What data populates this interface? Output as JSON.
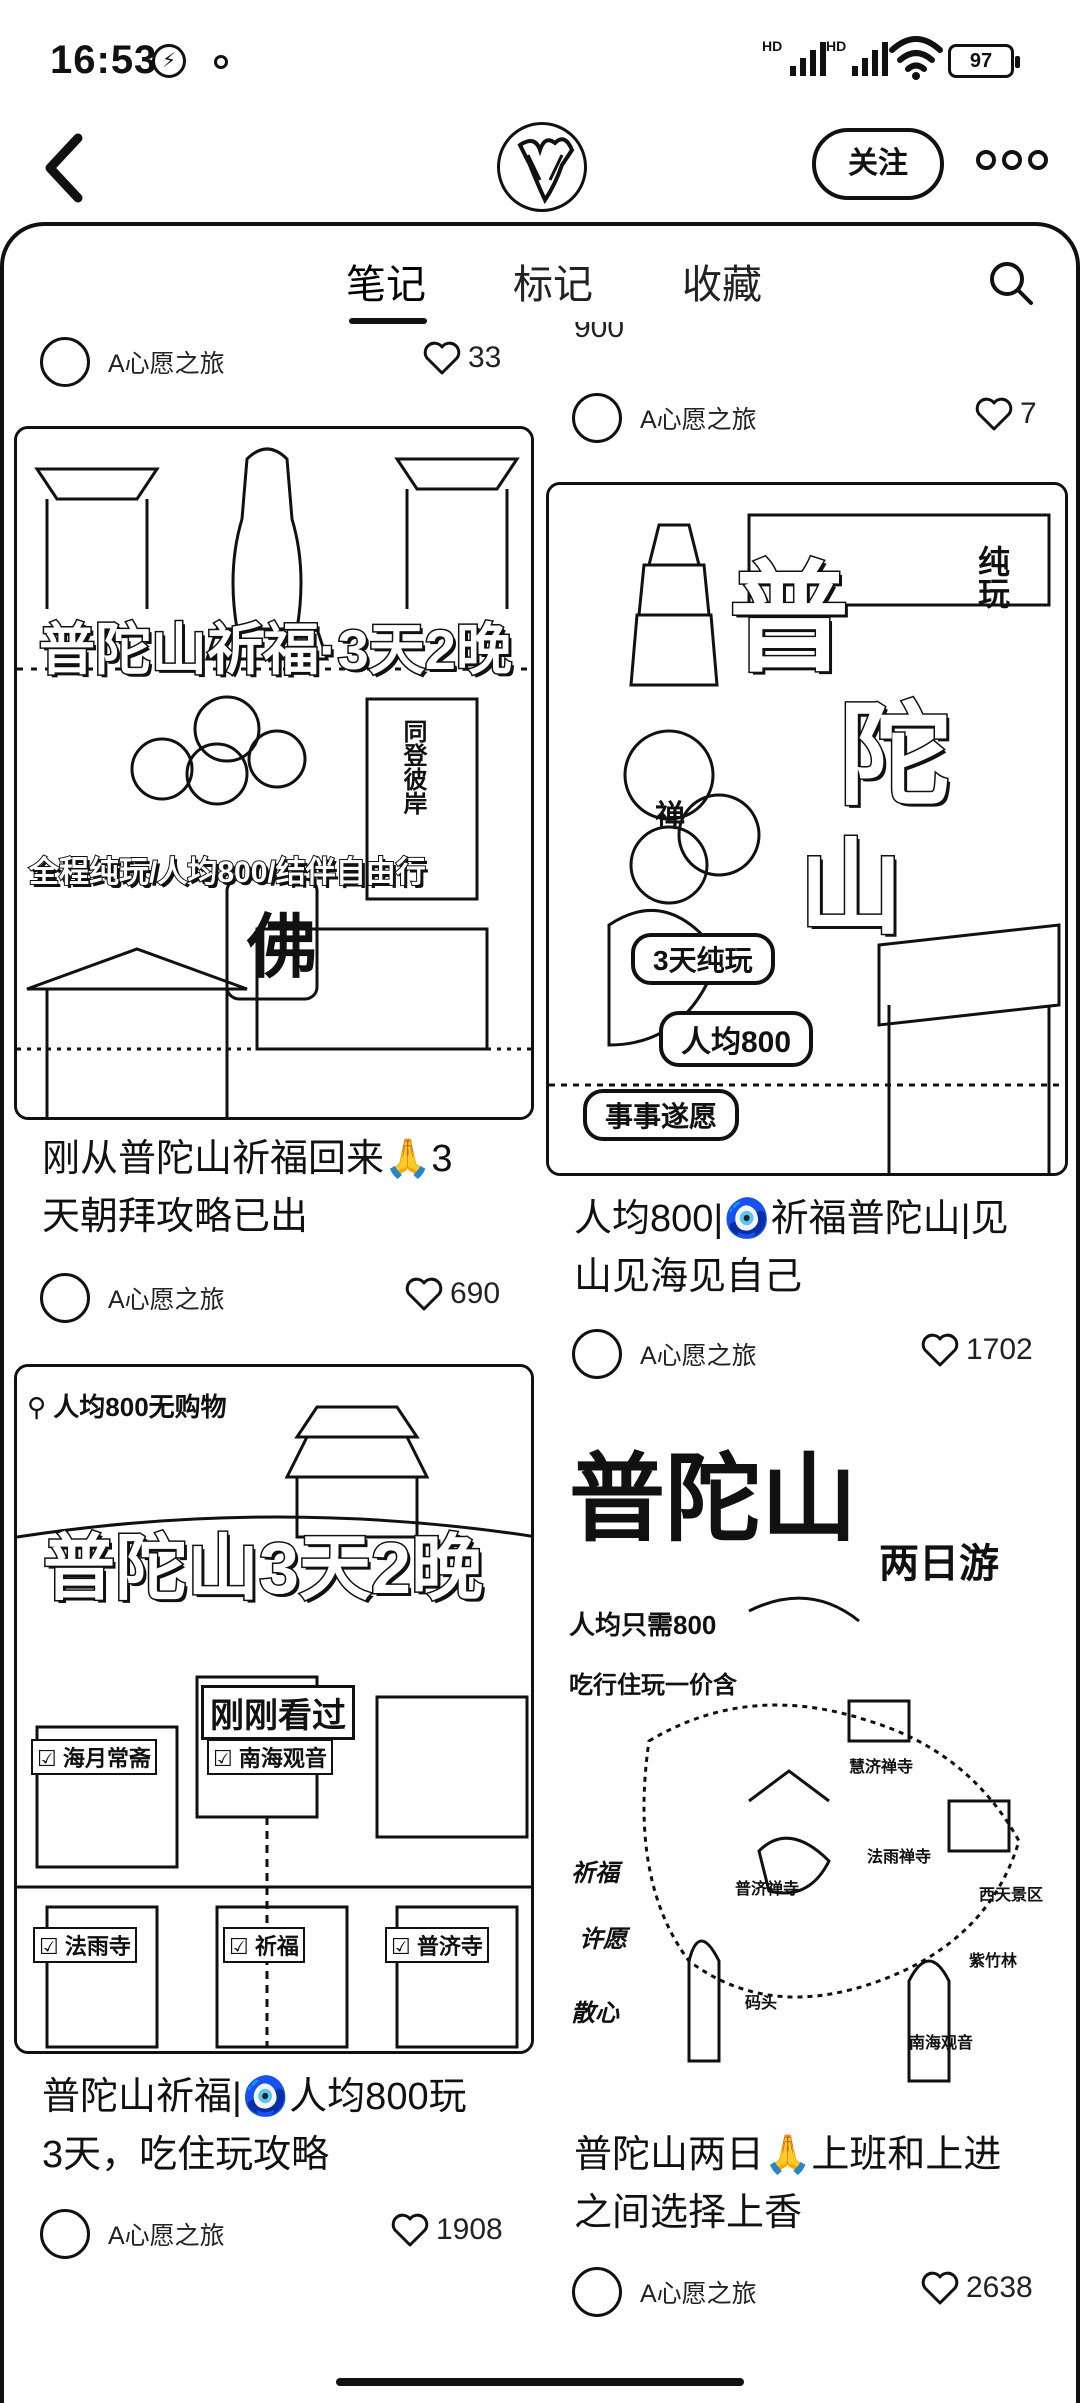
{
  "status_bar": {
    "time": "16:53",
    "battery": "97",
    "signal_1": "HD",
    "signal_2": "HD"
  },
  "header": {
    "follow_label": "关注"
  },
  "tabs": [
    {
      "label": "笔记",
      "active": true
    },
    {
      "label": "标记",
      "active": false
    },
    {
      "label": "收藏",
      "active": false
    }
  ],
  "feed": {
    "clipped_top_right_text": "900",
    "top_row": [
      {
        "author": "A心愿之旅",
        "likes": "33"
      },
      {
        "author": "A心愿之旅",
        "likes": "7"
      }
    ],
    "left_column": [
      {
        "title_line1": "刚从普陀山祈福回来🙏3",
        "title_line2": "天朝拜攻略已出",
        "author": "A心愿之旅",
        "likes": "690",
        "cover": {
          "headline": "普陀山祈福·3天2晚",
          "subline": "全程纯玩/人均800/结伴自由行",
          "big_char": "佛",
          "sign_text": "同登彼岸"
        }
      },
      {
        "title_line1": "普陀山祈福|🧿人均800玩",
        "title_line2": "3天，吃住玩攻略",
        "author": "A心愿之旅",
        "likes": "1908",
        "cover": {
          "tag": "人均800无购物",
          "headline": "普陀山3天2晚",
          "just_viewed": "刚刚看过",
          "checks": [
            "海月常斋",
            "南海观音",
            "法雨寺",
            "祈福",
            "普济寺"
          ]
        }
      }
    ],
    "right_column": [
      {
        "title_line1": "人均800|🧿祈福普陀山|见",
        "title_line2": "山见海见自己",
        "author": "A心愿之旅",
        "likes": "1702",
        "cover": {
          "big_chars": [
            "普",
            "陀",
            "山"
          ],
          "side_text": "纯玩",
          "pills": [
            "3天纯玩",
            "人均800",
            "事事遂愿"
          ],
          "cup_text": "禅"
        }
      },
      {
        "title_line1": "普陀山两日🙏上班和上进",
        "title_line2": "之间选择上香",
        "author": "A心愿之旅",
        "likes": "2638",
        "cover": {
          "headline": "普陀山",
          "subline": "两日游",
          "line1": "人均只需800",
          "line2": "吃行住玩一价含",
          "map_labels": [
            "慧济禅寺",
            "法雨禅寺",
            "普济禅寺",
            "西天景区",
            "紫竹林",
            "码头",
            "南海观音"
          ],
          "side_labels": [
            "祈福",
            "许愿",
            "散心"
          ]
        }
      }
    ]
  }
}
